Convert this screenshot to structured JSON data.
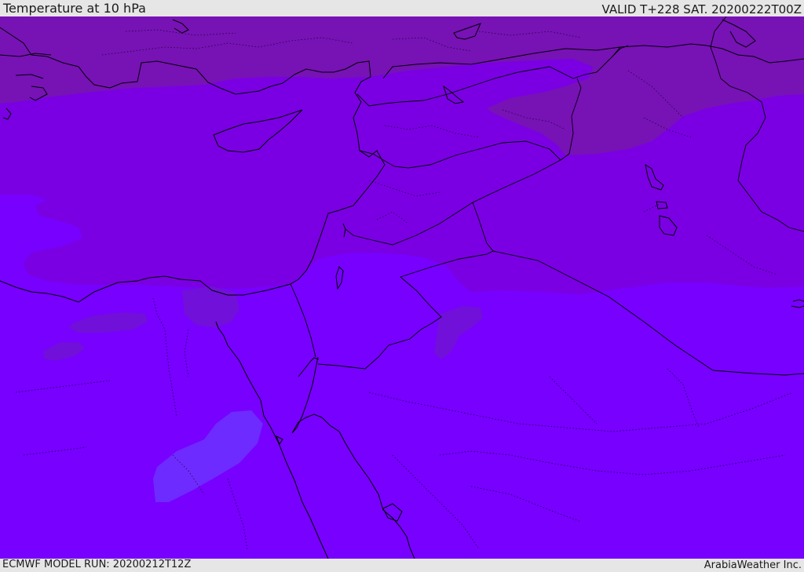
{
  "header": {
    "title": "Temperature at 10 hPa",
    "valid_time": "VALID T+228 SAT. 20200222T00Z"
  },
  "footer": {
    "model_run": "ECMWF MODEL RUN: 20200212T12Z",
    "credit": "ArabiaWeather Inc."
  },
  "map": {
    "colors": {
      "background_band": "#7700ff",
      "mid_band": "#7a00e3",
      "cold_band": "#7712b5",
      "pocket_cool": "#6e1adb",
      "pocket_warm": "#6b33ff",
      "coastline": "#000000",
      "frame_bar": "#e6e6e6"
    },
    "layers": [
      "temperature-shading",
      "coastlines",
      "country-borders",
      "province-borders"
    ]
  }
}
